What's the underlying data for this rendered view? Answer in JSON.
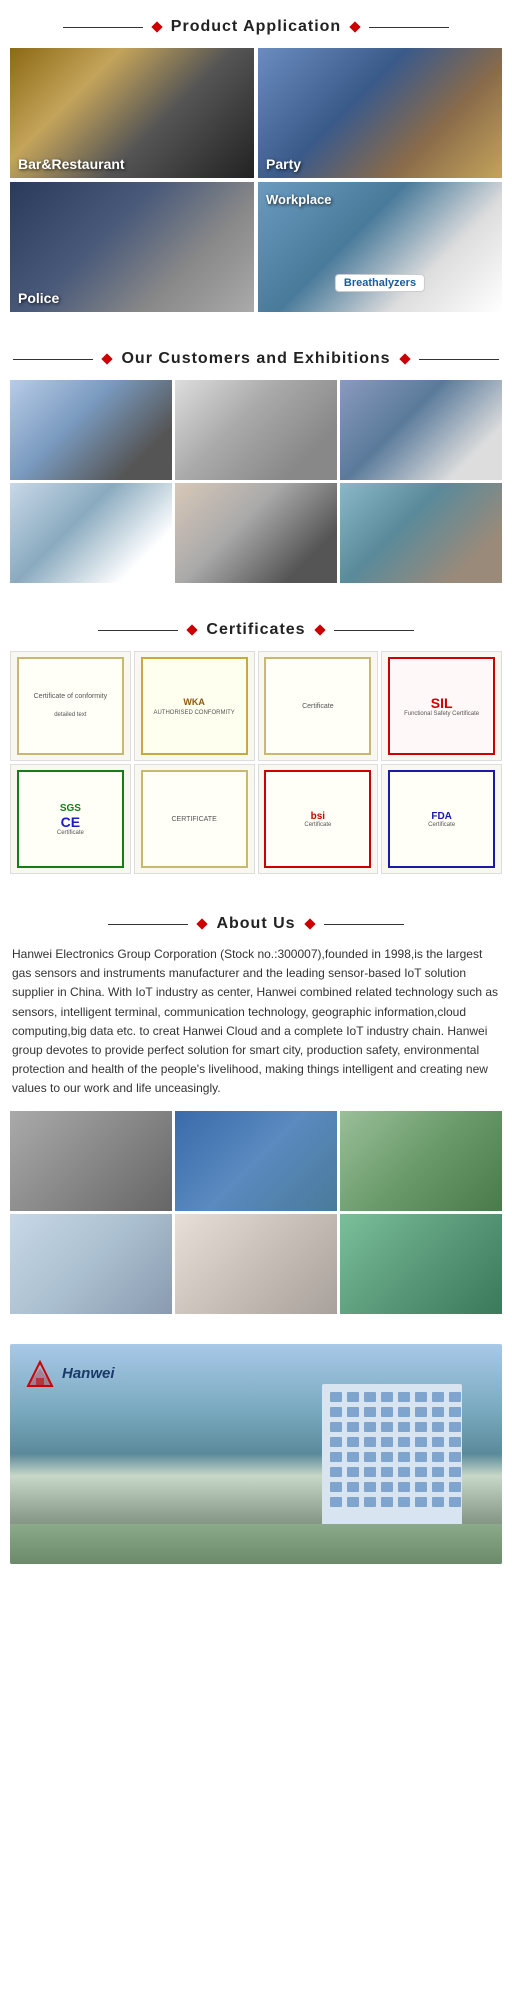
{
  "sections": {
    "product_application": {
      "title": "Product Application",
      "items": [
        {
          "id": "bar-restaurant",
          "label": "Bar&Restaurant",
          "imgClass": "img-bar-restaurant"
        },
        {
          "id": "party",
          "label": "Party",
          "imgClass": "img-party"
        },
        {
          "id": "police",
          "label": "Police",
          "imgClass": "img-police"
        },
        {
          "id": "workplace",
          "label": "Workplace",
          "imgClass": "img-workplace",
          "badge": "Breathalyzers",
          "special": true
        }
      ]
    },
    "customers": {
      "title": "Our Customers and Exhibitions",
      "items": [
        {
          "id": "expo1",
          "imgClass": "img-expo1"
        },
        {
          "id": "expo2",
          "imgClass": "img-expo2"
        },
        {
          "id": "expo3",
          "imgClass": "img-expo3"
        },
        {
          "id": "expo4",
          "imgClass": "img-expo4"
        },
        {
          "id": "expo5",
          "imgClass": "img-expo5"
        },
        {
          "id": "expo6",
          "imgClass": "img-expo6"
        }
      ]
    },
    "certificates": {
      "title": "Certificates",
      "row1": [
        {
          "id": "cert1",
          "type": "text",
          "logo": "",
          "text": "Certificate of conformity"
        },
        {
          "id": "cert2",
          "type": "logo",
          "logo": "WKA",
          "text": "AUTHORISED CONFORMITY"
        },
        {
          "id": "cert3",
          "type": "text",
          "logo": "",
          "text": "Certificate"
        },
        {
          "id": "cert4",
          "type": "sil",
          "logo": "SIL",
          "text": "Functional Safety Certificate",
          "red": true
        }
      ],
      "row2": [
        {
          "id": "cert5",
          "type": "sgs",
          "logo": "SGS",
          "text": "Certificate",
          "ce": "CE"
        },
        {
          "id": "cert6",
          "type": "text",
          "logo": "",
          "text": "CERTIFICATE"
        },
        {
          "id": "cert7",
          "type": "bsi",
          "logo": "bsi",
          "text": "Certificate"
        },
        {
          "id": "cert8",
          "type": "fda",
          "logo": "FDA",
          "text": "Certificate"
        }
      ]
    },
    "about": {
      "title": "About Us",
      "text": "Hanwei Electronics Group Corporation (Stock no.:300007),founded in 1998,is the largest gas sensors and instruments manufacturer and the leading sensor-based IoT solution supplier in China. With IoT industry as center, Hanwei combined related technology such as sensors, intelligent terminal, communication technology, geographic information,cloud computing,big data etc. to creat Hanwei Cloud and a complete IoT industry chain. Hanwei group devotes to provide perfect solution for smart city, production safety, environmental protection and health of the people's livelihood, making things intelligent and creating new values to our work and life unceasingly.",
      "photos_row1": [
        {
          "id": "f1",
          "imgClass": "img-factory1"
        },
        {
          "id": "f2",
          "imgClass": "img-factory2"
        },
        {
          "id": "f3",
          "imgClass": "img-factory3"
        }
      ],
      "photos_row2": [
        {
          "id": "f4",
          "imgClass": "img-factory4"
        },
        {
          "id": "f5",
          "imgClass": "img-factory5"
        },
        {
          "id": "f6",
          "imgClass": "img-factory6"
        }
      ]
    },
    "hanwei": {
      "name": "Hanwei"
    }
  }
}
